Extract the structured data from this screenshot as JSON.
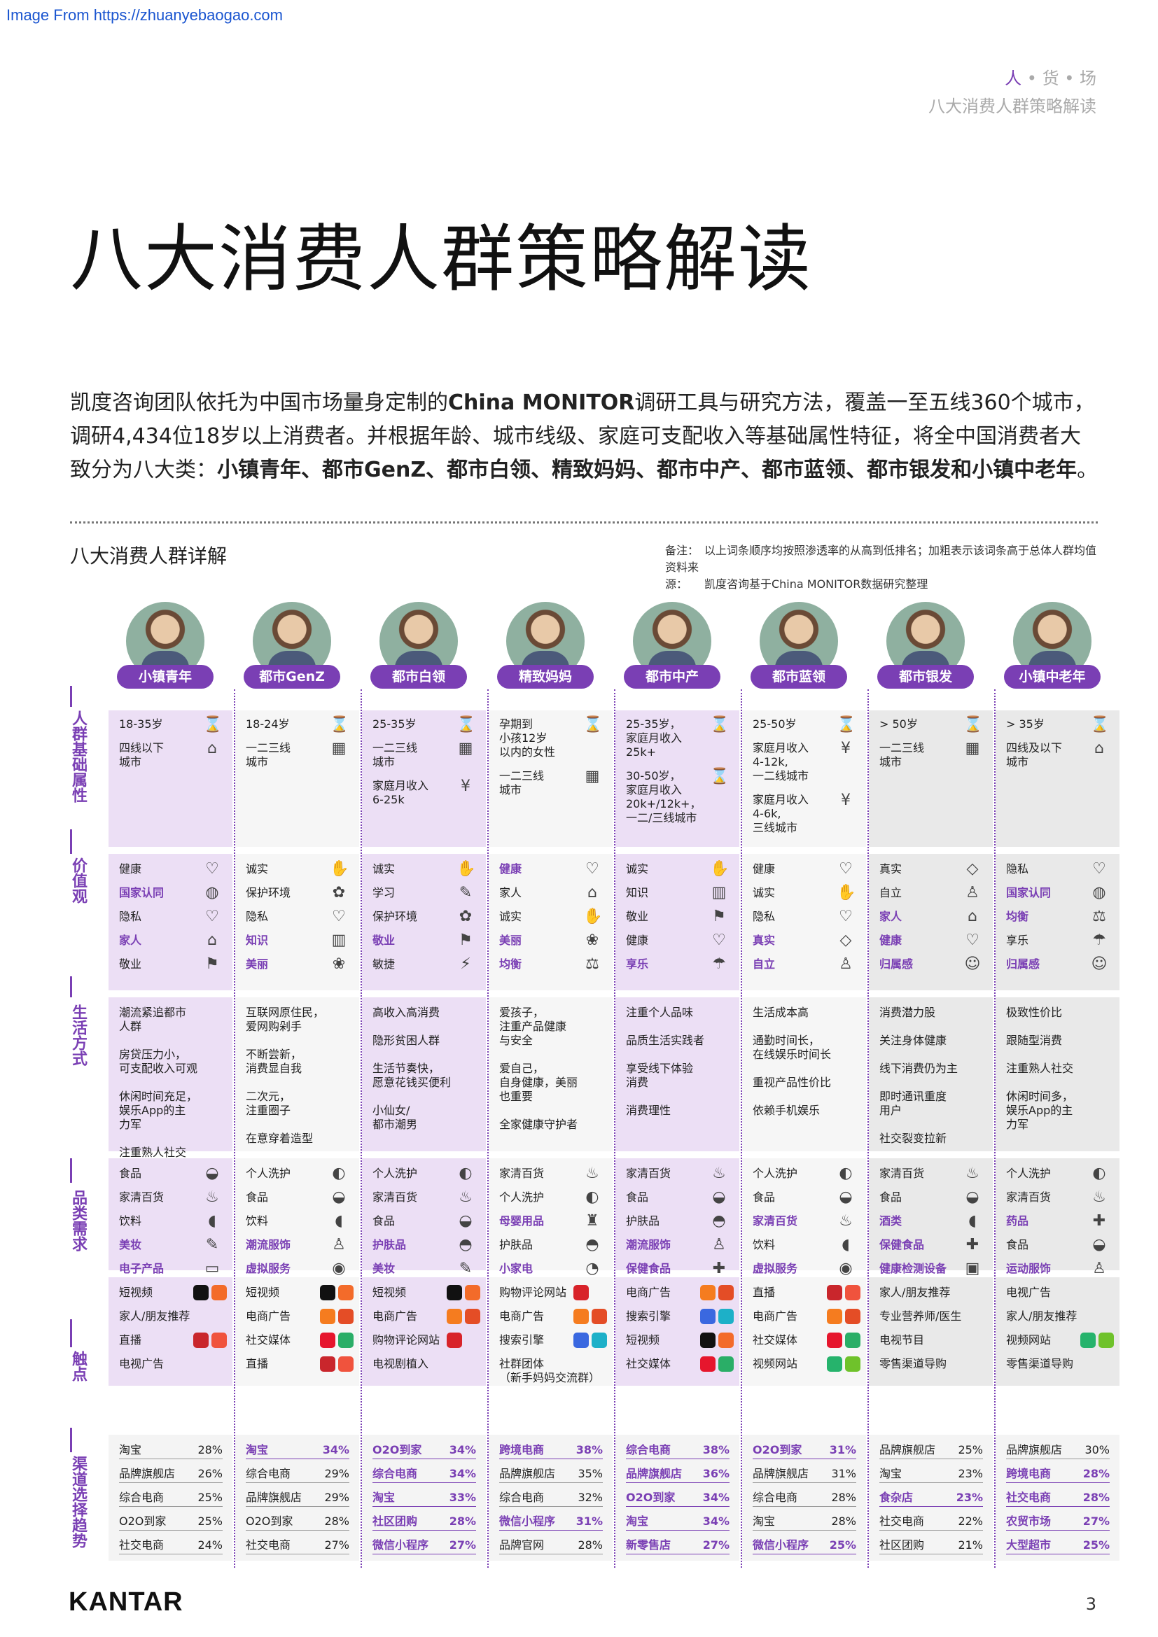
{
  "source": "Image From https://zhuanyebaogao.com",
  "crumb": {
    "a": "人",
    "b": "货",
    "c": "场",
    "sub": "八大消费人群策略解读"
  },
  "title": "八大消费人群策略解读",
  "intro": {
    "p1": "凯度咨询团队依托为中国市场量身定制的",
    "brand": "China MONITOR",
    "p2": "调研工具与研究方法，覆盖一至五线360个城市，调研4,434位18岁以上消费者。并根据年龄、城市线级、家庭可支配收入等基础属性特征，将全中国消费者大致分为八大类：",
    "groups": "小镇青年、都市GenZ、都市白领、精致妈妈、都市中产、都市蓝领、都市银发和小镇中老年",
    "end": "。"
  },
  "subtitle": "八大消费人群详解",
  "notes": {
    "note_label": "备注：",
    "note": "以上词条顺序均按照渗透率的从高到低排名；加粗表示该词条高于总体人群均值",
    "src_label": "资料来源：",
    "src": "凯度咨询基于China MONITOR数据研究整理"
  },
  "rows": [
    "人群基础属性",
    "价值观",
    "生活方式",
    "品类需求",
    "触点",
    "渠道选择趋势"
  ],
  "footer": {
    "brand": "KANTAR",
    "page": "3"
  },
  "segments": [
    {
      "name": "小镇青年",
      "accent": "#ecdff5",
      "basics": [
        {
          "t": "18-35岁",
          "i": "⌛"
        },
        {
          "t": "四线以下\n城市",
          "i": "⌂"
        }
      ],
      "values": [
        {
          "t": "健康",
          "b": false,
          "i": "♡"
        },
        {
          "t": "国家认同",
          "b": true,
          "i": "◍"
        },
        {
          "t": "隐私",
          "b": false,
          "i": "♡"
        },
        {
          "t": "家人",
          "b": true,
          "i": "⌂"
        },
        {
          "t": "敬业",
          "b": false,
          "i": "⚑"
        }
      ],
      "lifestyle": [
        "潮流紧追都市\n人群",
        "房贷压力小，\n可支配收入可观",
        "休闲时间充足，\n娱乐App的主\n力军",
        "注重熟人社交"
      ],
      "categories": [
        {
          "t": "食品",
          "b": false,
          "i": "◒"
        },
        {
          "t": "家清百货",
          "b": false,
          "i": "♨"
        },
        {
          "t": "饮料",
          "b": false,
          "i": "◖"
        },
        {
          "t": "美妆",
          "b": true,
          "i": "✎"
        },
        {
          "t": "电子产品",
          "b": true,
          "i": "▭"
        }
      ],
      "touch": [
        "短视频",
        "家人/朋友推荐",
        "直播",
        "电视广告"
      ],
      "channels": [
        {
          "t": "淘宝",
          "b": false,
          "p": "28%"
        },
        {
          "t": "品牌旗舰店",
          "b": false,
          "p": "26%"
        },
        {
          "t": "综合电商",
          "b": false,
          "p": "25%"
        },
        {
          "t": "O2O到家",
          "b": false,
          "p": "25%"
        },
        {
          "t": "社交电商",
          "b": false,
          "p": "24%"
        }
      ]
    },
    {
      "name": "都市GenZ",
      "accent": "#f6f6f6",
      "basics": [
        {
          "t": "18-24岁",
          "i": "⌛"
        },
        {
          "t": "一二三线\n城市",
          "i": "▦"
        }
      ],
      "values": [
        {
          "t": "诚实",
          "b": false,
          "i": "✋"
        },
        {
          "t": "保护环境",
          "b": false,
          "i": "✿"
        },
        {
          "t": "隐私",
          "b": false,
          "i": "♡"
        },
        {
          "t": "知识",
          "b": true,
          "i": "▥"
        },
        {
          "t": "美丽",
          "b": true,
          "i": "❀"
        }
      ],
      "lifestyle": [
        "互联网原住民，\n爱网购剁手",
        "不断尝新，\n消费显自我",
        "二次元，\n注重圈子",
        "在意穿着造型"
      ],
      "categories": [
        {
          "t": "个人洗护",
          "b": false,
          "i": "◐"
        },
        {
          "t": "食品",
          "b": false,
          "i": "◒"
        },
        {
          "t": "饮料",
          "b": false,
          "i": "◖"
        },
        {
          "t": "潮流服饰",
          "b": true,
          "i": "♙"
        },
        {
          "t": "虚拟服务",
          "b": true,
          "i": "◉"
        }
      ],
      "touch": [
        "短视频",
        "电商广告",
        "社交媒体",
        "直播"
      ],
      "channels": [
        {
          "t": "淘宝",
          "b": true,
          "p": "34%"
        },
        {
          "t": "综合电商",
          "b": false,
          "p": "29%"
        },
        {
          "t": "品牌旗舰店",
          "b": false,
          "p": "29%"
        },
        {
          "t": "O2O到家",
          "b": false,
          "p": "28%"
        },
        {
          "t": "社交电商",
          "b": false,
          "p": "27%"
        }
      ]
    },
    {
      "name": "都市白领",
      "accent": "#ecdff5",
      "basics": [
        {
          "t": "25-35岁",
          "i": "⌛"
        },
        {
          "t": "一二三线\n城市",
          "i": "▦"
        },
        {
          "t": "家庭月收入\n6-25k",
          "i": "¥"
        }
      ],
      "values": [
        {
          "t": "诚实",
          "b": false,
          "i": "✋"
        },
        {
          "t": "学习",
          "b": false,
          "i": "✎"
        },
        {
          "t": "保护环境",
          "b": false,
          "i": "✿"
        },
        {
          "t": "敬业",
          "b": true,
          "i": "⚑"
        },
        {
          "t": "敏捷",
          "b": false,
          "i": "⚡"
        }
      ],
      "lifestyle": [
        "高收入高消费",
        "隐形贫困人群",
        "生活节奏快，\n愿意花钱买便利",
        "小仙女/\n都市潮男"
      ],
      "categories": [
        {
          "t": "个人洗护",
          "b": false,
          "i": "◐"
        },
        {
          "t": "家清百货",
          "b": false,
          "i": "♨"
        },
        {
          "t": "食品",
          "b": false,
          "i": "◒"
        },
        {
          "t": "护肤品",
          "b": true,
          "i": "◓"
        },
        {
          "t": "美妆",
          "b": true,
          "i": "✎"
        }
      ],
      "touch": [
        "短视频",
        "电商广告",
        "购物评论网站",
        "电视剧植入"
      ],
      "channels": [
        {
          "t": "O2O到家",
          "b": true,
          "p": "34%"
        },
        {
          "t": "综合电商",
          "b": true,
          "p": "34%"
        },
        {
          "t": "淘宝",
          "b": true,
          "p": "33%"
        },
        {
          "t": "社区团购",
          "b": true,
          "p": "28%"
        },
        {
          "t": "微信小程序",
          "b": true,
          "p": "27%"
        }
      ]
    },
    {
      "name": "精致妈妈",
      "accent": "#f6f6f6",
      "basics": [
        {
          "t": "孕期到\n小孩12岁\n以内的女性",
          "i": "⌛"
        },
        {
          "t": "一二三线\n城市",
          "i": "▦"
        }
      ],
      "values": [
        {
          "t": "健康",
          "b": true,
          "i": "♡"
        },
        {
          "t": "家人",
          "b": false,
          "i": "⌂"
        },
        {
          "t": "诚实",
          "b": false,
          "i": "✋"
        },
        {
          "t": "美丽",
          "b": true,
          "i": "❀"
        },
        {
          "t": "均衡",
          "b": true,
          "i": "⚖"
        }
      ],
      "lifestyle": [
        "爱孩子，\n注重产品健康\n与安全",
        "爱自己，\n自身健康，美丽\n也重要",
        "全家健康守护者"
      ],
      "categories": [
        {
          "t": "家清百货",
          "b": false,
          "i": "♨"
        },
        {
          "t": "个人洗护",
          "b": false,
          "i": "◐"
        },
        {
          "t": "母婴用品",
          "b": true,
          "i": "♜"
        },
        {
          "t": "护肤品",
          "b": false,
          "i": "◓"
        },
        {
          "t": "小家电",
          "b": true,
          "i": "◔"
        }
      ],
      "touch": [
        "购物评论网站",
        "电商广告",
        "搜索引擎",
        "社群团体\n（新手妈妈交流群）"
      ],
      "channels": [
        {
          "t": "跨境电商",
          "b": true,
          "p": "38%"
        },
        {
          "t": "品牌旗舰店",
          "b": false,
          "p": "35%"
        },
        {
          "t": "综合电商",
          "b": false,
          "p": "32%"
        },
        {
          "t": "微信小程序",
          "b": true,
          "p": "31%"
        },
        {
          "t": "品牌官网",
          "b": false,
          "p": "28%"
        }
      ]
    },
    {
      "name": "都市中产",
      "accent": "#ecdff5",
      "basics": [
        {
          "t": "25-35岁，\n家庭月收入\n25k+",
          "i": "⌛"
        },
        {
          "t": "30-50岁，\n家庭月收入\n20k+/12k+，\n一二/三线城市",
          "i": "⌛"
        }
      ],
      "values": [
        {
          "t": "诚实",
          "b": false,
          "i": "✋"
        },
        {
          "t": "知识",
          "b": false,
          "i": "▥"
        },
        {
          "t": "敬业",
          "b": false,
          "i": "⚑"
        },
        {
          "t": "健康",
          "b": false,
          "i": "♡"
        },
        {
          "t": "享乐",
          "b": true,
          "i": "☂"
        }
      ],
      "lifestyle": [
        "注重个人品味",
        "品质生活实践者",
        "享受线下体验\n消费",
        "消费理性"
      ],
      "categories": [
        {
          "t": "家清百货",
          "b": false,
          "i": "♨"
        },
        {
          "t": "食品",
          "b": false,
          "i": "◒"
        },
        {
          "t": "护肤品",
          "b": false,
          "i": "◓"
        },
        {
          "t": "潮流服饰",
          "b": true,
          "i": "♙"
        },
        {
          "t": "保健食品",
          "b": true,
          "i": "✚"
        }
      ],
      "touch": [
        "电商广告",
        "搜索引擎",
        "短视频",
        "社交媒体"
      ],
      "channels": [
        {
          "t": "综合电商",
          "b": true,
          "p": "38%"
        },
        {
          "t": "品牌旗舰店",
          "b": true,
          "p": "36%"
        },
        {
          "t": "O2O到家",
          "b": true,
          "p": "34%"
        },
        {
          "t": "淘宝",
          "b": true,
          "p": "34%"
        },
        {
          "t": "新零售店",
          "b": true,
          "p": "27%"
        }
      ]
    },
    {
      "name": "都市蓝领",
      "accent": "#f6f6f6",
      "basics": [
        {
          "t": "25-50岁",
          "i": "⌛"
        },
        {
          "t": "家庭月收入\n4-12k,\n一二线城市",
          "i": "¥"
        },
        {
          "t": "家庭月收入\n4-6k,\n三线城市",
          "i": "¥"
        }
      ],
      "values": [
        {
          "t": "健康",
          "b": false,
          "i": "♡"
        },
        {
          "t": "诚实",
          "b": false,
          "i": "✋"
        },
        {
          "t": "隐私",
          "b": false,
          "i": "♡"
        },
        {
          "t": "真实",
          "b": true,
          "i": "◇"
        },
        {
          "t": "自立",
          "b": true,
          "i": "♙"
        }
      ],
      "lifestyle": [
        "生活成本高",
        "通勤时间长，\n在线娱乐时间长",
        "重视产品性价比",
        "依赖手机娱乐"
      ],
      "categories": [
        {
          "t": "个人洗护",
          "b": false,
          "i": "◐"
        },
        {
          "t": "食品",
          "b": false,
          "i": "◒"
        },
        {
          "t": "家清百货",
          "b": true,
          "i": "♨"
        },
        {
          "t": "饮料",
          "b": false,
          "i": "◖"
        },
        {
          "t": "虚拟服务",
          "b": true,
          "i": "◉"
        }
      ],
      "touch": [
        "直播",
        "电商广告",
        "社交媒体",
        "视频网站"
      ],
      "channels": [
        {
          "t": "O2O到家",
          "b": true,
          "p": "31%"
        },
        {
          "t": "品牌旗舰店",
          "b": false,
          "p": "31%"
        },
        {
          "t": "综合电商",
          "b": false,
          "p": "28%"
        },
        {
          "t": "淘宝",
          "b": false,
          "p": "28%"
        },
        {
          "t": "微信小程序",
          "b": true,
          "p": "25%"
        }
      ]
    },
    {
      "name": "都市银发",
      "accent": "#e9e9e9",
      "basics": [
        {
          "t": "> 50岁",
          "i": "⌛"
        },
        {
          "t": "一二三线\n城市",
          "i": "▦"
        }
      ],
      "values": [
        {
          "t": "真实",
          "b": false,
          "i": "◇"
        },
        {
          "t": "自立",
          "b": false,
          "i": "♙"
        },
        {
          "t": "家人",
          "b": true,
          "i": "⌂"
        },
        {
          "t": "健康",
          "b": true,
          "i": "♡"
        },
        {
          "t": "归属感",
          "b": true,
          "i": "☺"
        }
      ],
      "lifestyle": [
        "消费潜力股",
        "关注身体健康",
        "线下消费仍为主",
        "即时通讯重度\n用户",
        "社交裂变拉新"
      ],
      "categories": [
        {
          "t": "家清百货",
          "b": false,
          "i": "♨"
        },
        {
          "t": "食品",
          "b": false,
          "i": "◒"
        },
        {
          "t": "酒类",
          "b": true,
          "i": "◖"
        },
        {
          "t": "保健食品",
          "b": true,
          "i": "✚"
        },
        {
          "t": "健康检测设备",
          "b": true,
          "i": "▣"
        }
      ],
      "touch": [
        "家人/朋友推荐",
        "专业营养师/医生",
        "电视节目",
        "零售渠道导购"
      ],
      "channels": [
        {
          "t": "品牌旗舰店",
          "b": false,
          "p": "25%"
        },
        {
          "t": "淘宝",
          "b": false,
          "p": "23%"
        },
        {
          "t": "食杂店",
          "b": true,
          "p": "23%"
        },
        {
          "t": "社交电商",
          "b": false,
          "p": "22%"
        },
        {
          "t": "社区团购",
          "b": false,
          "p": "21%"
        }
      ]
    },
    {
      "name": "小镇中老年",
      "accent": "#e9e9e9",
      "basics": [
        {
          "t": "> 35岁",
          "i": "⌛"
        },
        {
          "t": "四线及以下\n城市",
          "i": "⌂"
        }
      ],
      "values": [
        {
          "t": "隐私",
          "b": false,
          "i": "♡"
        },
        {
          "t": "国家认同",
          "b": true,
          "i": "◍"
        },
        {
          "t": "均衡",
          "b": true,
          "i": "⚖"
        },
        {
          "t": "享乐",
          "b": false,
          "i": "☂"
        },
        {
          "t": "归属感",
          "b": true,
          "i": "☺"
        }
      ],
      "lifestyle": [
        "极致性价比",
        "跟随型消费",
        "注重熟人社交",
        "休闲时间多，\n娱乐App的主\n力军"
      ],
      "categories": [
        {
          "t": "个人洗护",
          "b": false,
          "i": "◐"
        },
        {
          "t": "家清百货",
          "b": false,
          "i": "♨"
        },
        {
          "t": "药品",
          "b": true,
          "i": "✚"
        },
        {
          "t": "食品",
          "b": false,
          "i": "◒"
        },
        {
          "t": "运动服饰",
          "b": true,
          "i": "♙"
        }
      ],
      "touch": [
        "电视广告",
        "家人/朋友推荐",
        "视频网站",
        "零售渠道导购"
      ],
      "channels": [
        {
          "t": "品牌旗舰店",
          "b": false,
          "p": "30%"
        },
        {
          "t": "跨境电商",
          "b": true,
          "p": "28%"
        },
        {
          "t": "社交电商",
          "b": true,
          "p": "28%"
        },
        {
          "t": "农贸市场",
          "b": true,
          "p": "27%"
        },
        {
          "t": "大型超市",
          "b": true,
          "p": "25%"
        }
      ]
    }
  ]
}
